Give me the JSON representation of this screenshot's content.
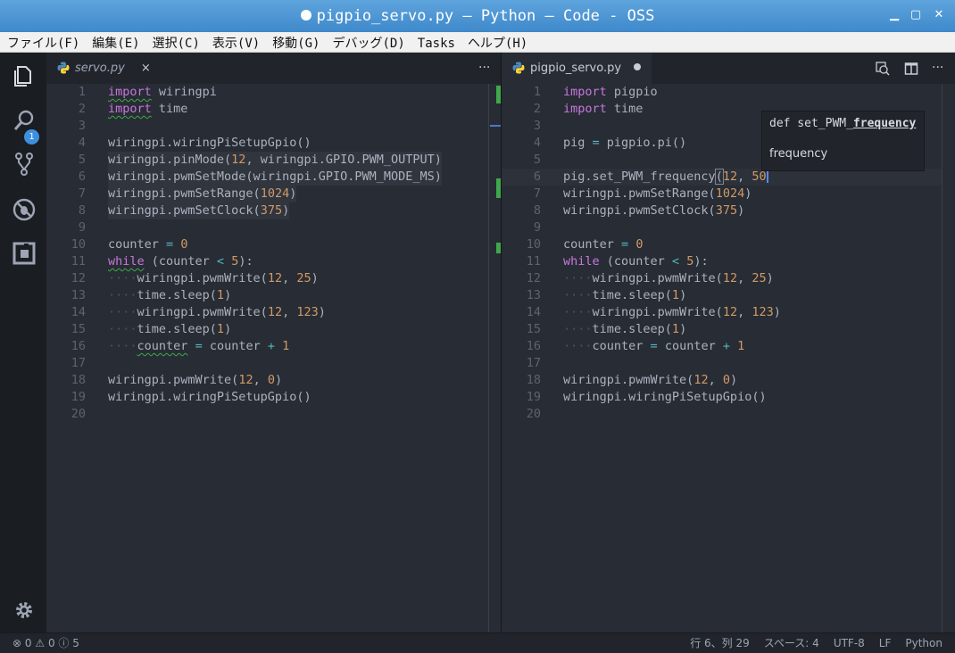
{
  "window": {
    "title": "pigpio_servo.py — Python — Code - OSS"
  },
  "menu": [
    "ファイル(F)",
    "編集(E)",
    "選択(C)",
    "表示(V)",
    "移動(G)",
    "デバッグ(D)",
    "Tasks",
    "ヘルプ(H)"
  ],
  "activity": {
    "icons": [
      "files-icon",
      "search-icon",
      "source-control-icon",
      "debug-icon",
      "extensions-icon",
      "settings-gear-icon"
    ],
    "badge": "1"
  },
  "left_editor": {
    "tab_label": "servo.py",
    "tab_close": "×",
    "more": "···"
  },
  "right_editor": {
    "tab_label": "pigpio_servo.py",
    "more": "···"
  },
  "hover": {
    "signature_prefix": "def set_PWM_",
    "signature_bold": "frequency",
    "doc": "frequency"
  },
  "status": {
    "errors": "0",
    "warnings": "0",
    "info": "5",
    "position": "行 6、列 29",
    "spaces": "スペース: 4",
    "encoding": "UTF-8",
    "eol": "LF",
    "language": "Python"
  },
  "colors": {
    "keyword": "#c678dd",
    "number": "#d19a66",
    "operator": "#56b6c2",
    "text": "#abb2bf",
    "title_bar": "#4a93d3"
  }
}
